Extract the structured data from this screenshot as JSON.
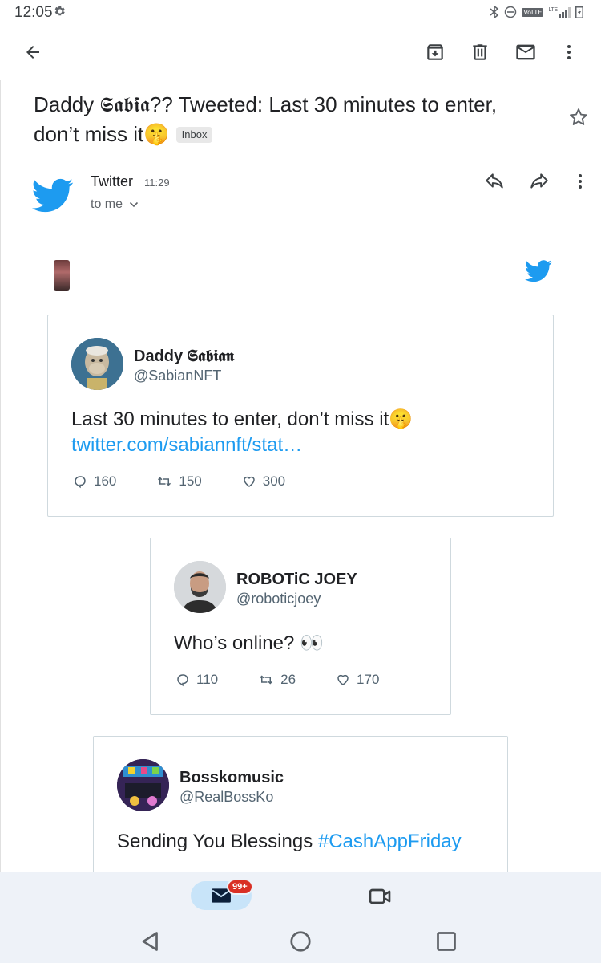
{
  "status_bar": {
    "time": "12:05",
    "network_badge": "VoLTE",
    "lte_label": "LTE"
  },
  "toolbar": {
    "icons": [
      "back-arrow-icon",
      "archive-icon",
      "delete-icon",
      "mark-unread-icon",
      "more-vert-icon"
    ]
  },
  "email": {
    "subject": "Daddy 𝕾𝖆𝖇𝖎́𝖆?? Tweeted: Last 30 minutes to enter, don’t miss it🤫",
    "label_chip": "Inbox",
    "sender": "Twitter",
    "time": "11:29",
    "recipient": "to me"
  },
  "tweets": [
    {
      "name": "Daddy 𝕾𝖆𝖇𝖎𝖆𝖓",
      "handle": "@SabianNFT",
      "text": "Last 30 minutes to enter, don’t miss it🤫",
      "link": "twitter.com/sabiannft/stat…",
      "replies": "160",
      "retweets": "150",
      "likes": "300"
    },
    {
      "name": "ROBOTiC JOEY",
      "handle": "@roboticjoey",
      "text": "Who’s online? 👀",
      "replies": "110",
      "retweets": "26",
      "likes": "170"
    },
    {
      "name": "Bosskomusic",
      "handle": "@RealBossKo",
      "text_plain": "Sending You Blessings ",
      "hashtag": "#CashAppFriday"
    }
  ],
  "bottom_nav": {
    "mail_badge": "99+"
  },
  "colors": {
    "twitter_blue": "#1d9bf0",
    "badge_red": "#d93025",
    "nav_bg": "#eef2f8",
    "pill_bg": "#c8e4f9"
  }
}
